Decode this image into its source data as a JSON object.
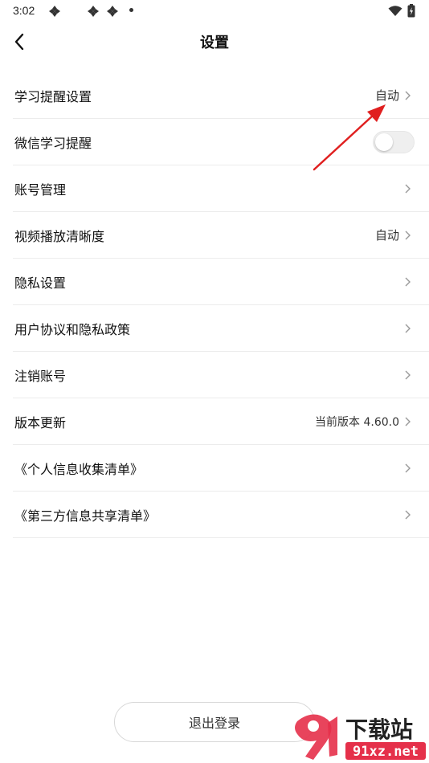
{
  "status_bar": {
    "time": "3:02"
  },
  "header": {
    "title": "设置"
  },
  "settings": {
    "rows": [
      {
        "label": "学习提醒设置",
        "value": "自动"
      },
      {
        "label": "微信学习提醒",
        "toggle": false
      },
      {
        "label": "账号管理",
        "value": ""
      },
      {
        "label": "视频播放清晰度",
        "value": "自动"
      },
      {
        "label": "隐私设置",
        "value": ""
      },
      {
        "label": "用户协议和隐私政策",
        "value": ""
      },
      {
        "label": "注销账号",
        "value": ""
      },
      {
        "label": "版本更新",
        "value": "当前版本 4.60.0"
      },
      {
        "label": "《个人信息收集清单》",
        "value": ""
      },
      {
        "label": "《第三方信息共享清单》",
        "value": ""
      }
    ]
  },
  "footer": {
    "logout_label": "退出登录"
  },
  "watermark": {
    "brand": "下载站",
    "domain": "91xz.net"
  },
  "colors": {
    "annotation_arrow": "#e02020",
    "divider": "#ececec",
    "watermark_red": "#e5304a"
  }
}
